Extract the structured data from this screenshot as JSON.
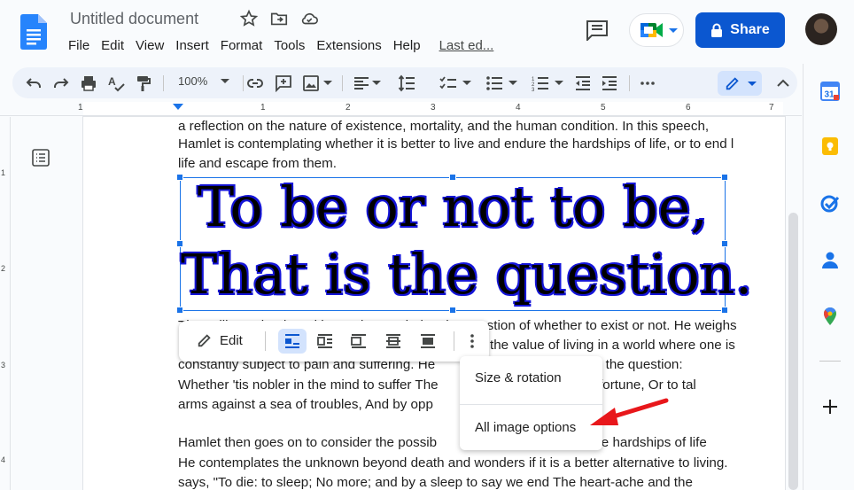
{
  "header": {
    "title": "Untitled document",
    "menu": [
      "File",
      "Edit",
      "View",
      "Insert",
      "Format",
      "Tools",
      "Extensions",
      "Help"
    ],
    "last_edit": "Last ed...",
    "share_label": "Share"
  },
  "toolbar": {
    "zoom": "100%"
  },
  "ruler": {
    "numbers": [
      "1",
      "1",
      "2",
      "3",
      "4",
      "5",
      "6",
      "7"
    ],
    "vertical_numbers": [
      "1",
      "2",
      "3",
      "4"
    ]
  },
  "document": {
    "paragraphs_top": [
      "a reflection on the nature of existence, mortality, and the human condition. In this speech,",
      "Hamlet is contemplating whether it is better to live and endure the hardships of life, or to end l",
      "life and escape from them."
    ],
    "image_text_line1": "To be or not to be,",
    "image_text_line2": "That is the question.",
    "paragraphs_middle": [
      "The soliloquy begins with Hamlet pondering the question of whether to exist or not. He weighs",
      "the value of living in a world where one is",
      "constantly subject to pain and suffering. He                          o be, that is the question:",
      "Whether 'tis nobler in the mind to suffer The                        outrageous fortune, Or to tal",
      "arms against a sea of troubles, And by opp"
    ],
    "paragraphs_bottom": [
      "Hamlet then goes on to consider the possib                        ease from the hardships of life",
      "He contemplates the unknown beyond death and wonders if it is a better alternative to living.",
      "says, \"To die: to sleep; No more; and by a sleep to say we end The heart-ache and the"
    ]
  },
  "image_toolbar": {
    "edit_label": "Edit"
  },
  "context_menu": {
    "items": [
      "Size & rotation",
      "All image options"
    ]
  },
  "colors": {
    "share_blue": "#0b57d0",
    "selection_blue": "#1a73e8",
    "annotation_arrow": "#e8171b"
  }
}
